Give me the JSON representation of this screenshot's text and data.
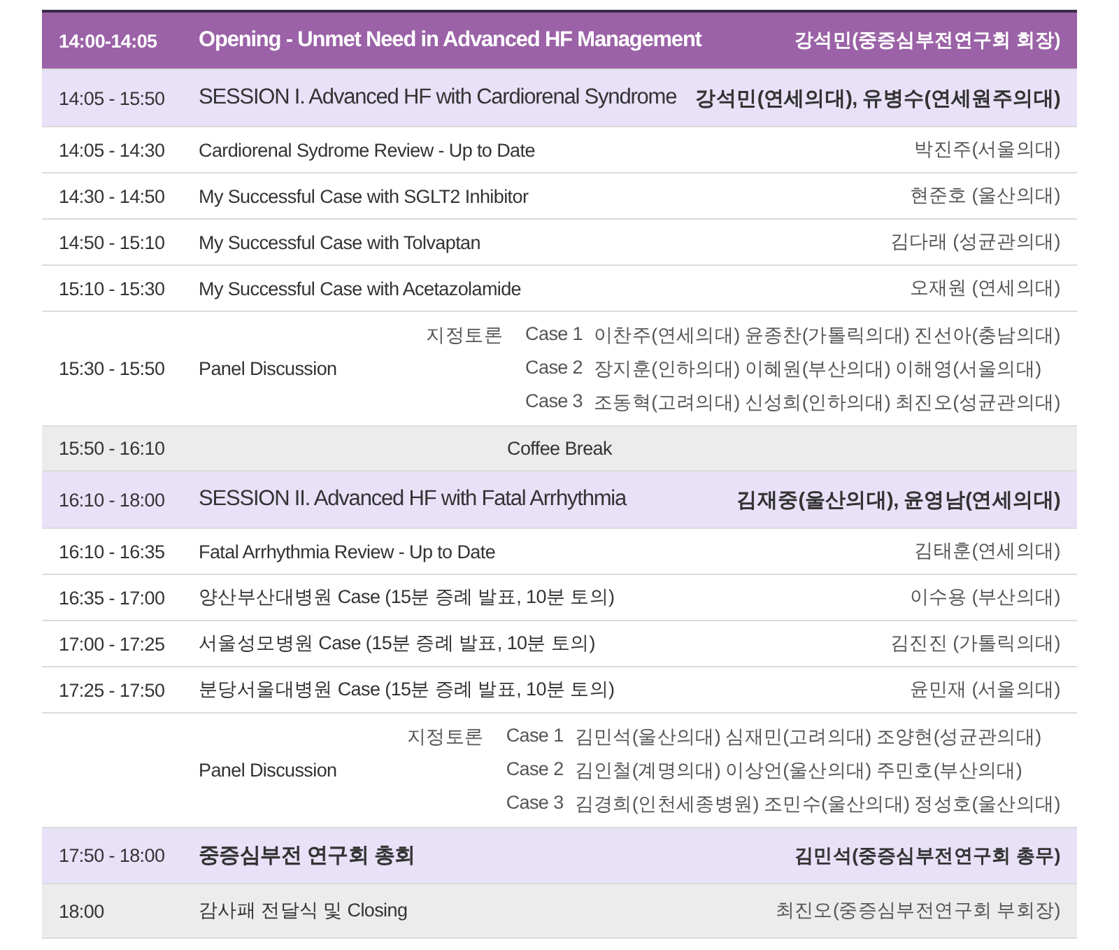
{
  "rows": [
    {
      "kind": "opening",
      "time": "14:00-14:05",
      "title": "Opening - Unmet Need in Advanced HF Management",
      "speaker": "강석민(중증심부전연구회 회장)"
    },
    {
      "kind": "session",
      "time": "14:05 - 15:50",
      "title": "SESSION I. Advanced HF with Cardiorenal Syndrome",
      "speaker": "강석민(연세의대), 유병수(연세원주의대)"
    },
    {
      "kind": "talk",
      "time": "14:05 - 14:30",
      "title": "Cardiorenal Sydrome Review - Up to Date",
      "speaker": "박진주(서울의대)"
    },
    {
      "kind": "talk",
      "time": "14:30 - 14:50",
      "title": "My Successful Case with SGLT2 Inhibitor",
      "speaker": "현준호 (울산의대)"
    },
    {
      "kind": "talk",
      "time": "14:50 - 15:10",
      "title": "My Successful Case with Tolvaptan",
      "speaker": "김다래 (성균관의대)"
    },
    {
      "kind": "talk",
      "time": "15:10 - 15:30",
      "title": "My Successful Case with Acetazolamide",
      "speaker": "오재원 (연세의대)"
    },
    {
      "kind": "panel",
      "time": "15:30 - 15:50",
      "title": "Panel Discussion",
      "label": "지정토론",
      "cases": [
        {
          "case": "Case 1",
          "names": "이찬주(연세의대) 윤종찬(가톨릭의대) 진선아(충남의대)"
        },
        {
          "case": "Case 2",
          "names": "장지훈(인하의대) 이혜원(부산의대) 이해영(서울의대)"
        },
        {
          "case": "Case 3",
          "names": "조동혁(고려의대) 신성희(인하의대) 최진오(성균관의대)"
        }
      ]
    },
    {
      "kind": "break",
      "time": "15:50 - 16:10",
      "title": "Coffee Break"
    },
    {
      "kind": "session",
      "time": "16:10 - 18:00",
      "title": "SESSION II. Advanced HF with Fatal Arrhythmia",
      "speaker": "김재중(울산의대), 윤영남(연세의대)"
    },
    {
      "kind": "talk",
      "time": "16:10 - 16:35",
      "title": "Fatal Arrhythmia Review - Up to Date",
      "speaker": "김태훈(연세의대)"
    },
    {
      "kind": "talk",
      "time": "16:35 - 17:00",
      "title": "양산부산대병원 Case (15분 증례 발표, 10분 토의)",
      "speaker": "이수용 (부산의대)"
    },
    {
      "kind": "talk",
      "time": "17:00 - 17:25",
      "title": "서울성모병원 Case (15분 증례 발표, 10분 토의)",
      "speaker": "김진진 (가톨릭의대)"
    },
    {
      "kind": "talk",
      "time": "17:25 - 17:50",
      "title": "분당서울대병원 Case (15분 증례 발표, 10분 토의)",
      "speaker": "윤민재 (서울의대)"
    },
    {
      "kind": "panel",
      "title": "Panel Discussion",
      "label": "지정토론",
      "cases": [
        {
          "case": "Case 1",
          "names": "김민석(울산의대) 심재민(고려의대) 조양현(성균관의대)"
        },
        {
          "case": "Case 2",
          "names": "김인철(계명의대) 이상언(울산의대) 주민호(부산의대)"
        },
        {
          "case": "Case 3",
          "names": "김경희(인천세종병원) 조민수(울산의대) 정성호(울산의대)"
        }
      ]
    },
    {
      "kind": "meeting",
      "time": "17:50 - 18:00",
      "title": "중증심부전 연구회 총회",
      "speaker": "김민석(중증심부전연구회 총무)"
    },
    {
      "kind": "closing",
      "time": "18:00",
      "title": "감사패 전달식 및 Closing",
      "speaker": "최진오(중증심부전연구회 부회장)"
    }
  ]
}
